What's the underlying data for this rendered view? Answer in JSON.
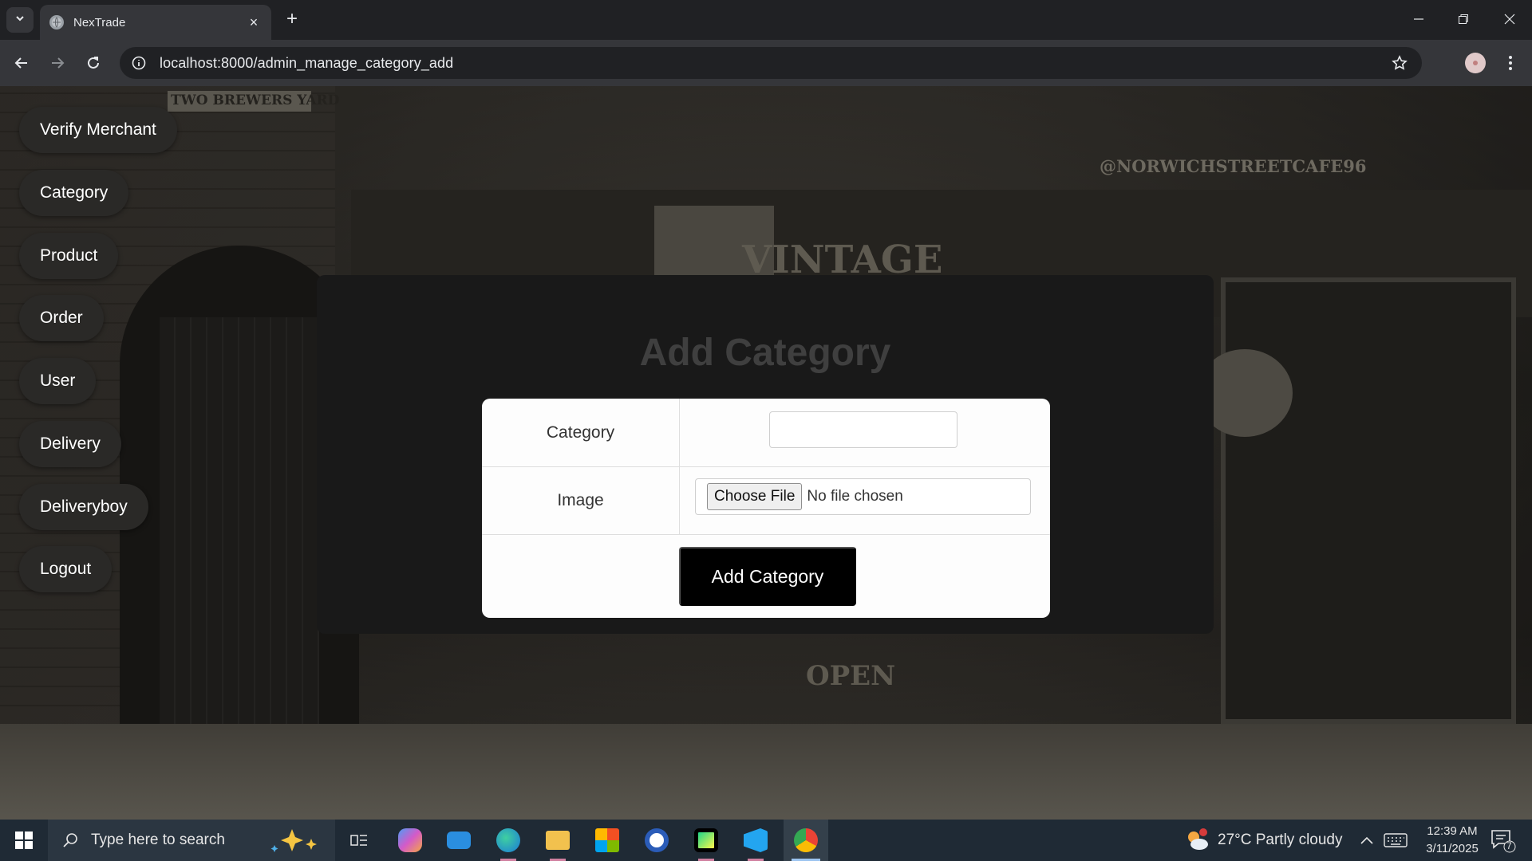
{
  "browser": {
    "tab_title": "NexTrade",
    "url": "localhost:8000/admin_manage_category_add"
  },
  "sidenav": {
    "items": [
      {
        "label": "Verify Merchant"
      },
      {
        "label": "Category"
      },
      {
        "label": "Product"
      },
      {
        "label": "Order"
      },
      {
        "label": "User"
      },
      {
        "label": "Delivery"
      },
      {
        "label": "Deliveryboy"
      },
      {
        "label": "Logout"
      }
    ]
  },
  "form": {
    "title": "Add Category",
    "category_label": "Category",
    "category_value": "",
    "image_label": "Image",
    "file_button": "Choose File",
    "file_status": "No file chosen",
    "submit_label": "Add Category"
  },
  "background_signs": {
    "yard": "TWO BREWERS YARD",
    "handle": "@NORWICHSTREETCAFE96",
    "vintage": "VINTAGE",
    "open": "OPEN"
  },
  "taskbar": {
    "search_placeholder": "Type here to search",
    "weather": "27°C  Partly cloudy",
    "time": "12:39 AM",
    "date": "3/11/2025",
    "notification_count": "7",
    "apps": [
      "copilot-icon",
      "mail-icon",
      "edge-icon",
      "file-explorer-icon",
      "store-icon",
      "word-icon",
      "pycharm-icon",
      "vscode-icon",
      "chrome-icon"
    ]
  },
  "colors": {
    "panel": "#191919",
    "title_text": "#3f3f3f",
    "submit_bg": "#000000",
    "nav_pill": "#2a2927",
    "taskbar": "#1f2a35"
  }
}
